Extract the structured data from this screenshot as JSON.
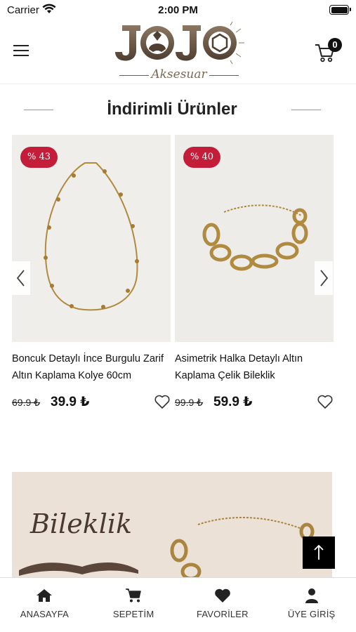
{
  "status_bar": {
    "carrier": "Carrier",
    "time": "2:00 PM"
  },
  "header": {
    "logo_text": "JOJO",
    "logo_subtitle": "Aksesuar",
    "cart_count": "0"
  },
  "section": {
    "title": "İndirimli Ürünler"
  },
  "products": [
    {
      "discount": "% 43",
      "name": "Boncuk Detaylı İnce Burgulu Zarif Altın Kaplama Kolye 60cm",
      "old_price": "69.9 ₺",
      "new_price": "39.9 ₺"
    },
    {
      "discount": "% 40",
      "name": "Asimetrik Halka Detaylı Altın Kaplama Çelik Bileklik",
      "old_price": "99.9 ₺",
      "new_price": "59.9 ₺"
    }
  ],
  "banner": {
    "title": "Bileklik"
  },
  "tab_bar": {
    "tabs": [
      {
        "label": "ANASAYFA",
        "icon": "home-icon"
      },
      {
        "label": "SEPETİM",
        "icon": "cart-icon"
      },
      {
        "label": "FAVORİLER",
        "icon": "heart-icon"
      },
      {
        "label": "ÜYE GİRİŞ",
        "icon": "user-icon"
      }
    ]
  },
  "colors": {
    "discount_badge": "#c41d3a",
    "logo_brown": "#6c5b4a",
    "banner_bg": "#ece1d6"
  }
}
